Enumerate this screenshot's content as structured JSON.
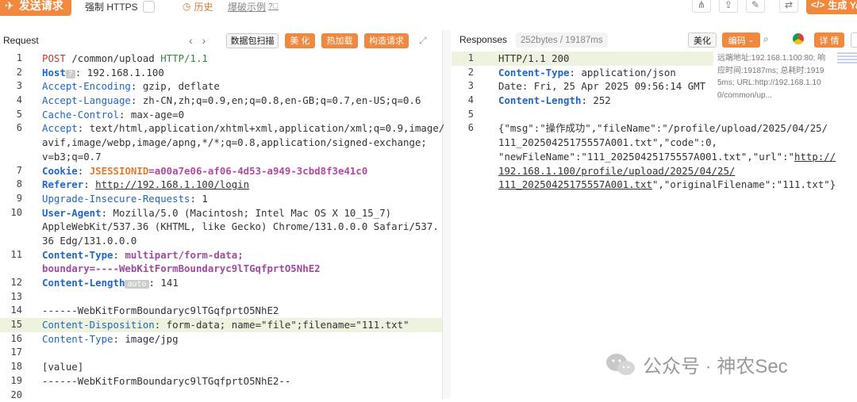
{
  "toolbar": {
    "send_label": "发送请求",
    "https_label": "强制 HTTPS",
    "history_label": "历史",
    "fuzz_label": "爆破示例",
    "generate_label": "生成 Ya"
  },
  "request": {
    "title": "Request",
    "btn_scan": "数据包扫描",
    "btn_beautify": "美 化",
    "btn_hotload": "热加载",
    "btn_construct": "构造请求"
  },
  "response": {
    "title": "Responses",
    "meta": "252bytes / 19187ms",
    "btn_beautify": "美化",
    "btn_encoding": "编码",
    "btn_detail": "详 情",
    "info_line1": "远端地址:192.168.1.100:80; 响",
    "info_line2": "应时间:19187ms; 总耗时:1919",
    "info_line3": "5ms; URL:http://192.168.1.10",
    "info_line4": "0/common/up..."
  },
  "request_lines": [
    {
      "n": "1"
    },
    {
      "n": "2"
    },
    {
      "n": "3"
    },
    {
      "n": "4"
    },
    {
      "n": "5"
    },
    {
      "n": "6"
    },
    {
      "n": ""
    },
    {
      "n": ""
    },
    {
      "n": "7"
    },
    {
      "n": "8"
    },
    {
      "n": "9"
    },
    {
      "n": "10"
    },
    {
      "n": ""
    },
    {
      "n": ""
    },
    {
      "n": "11"
    },
    {
      "n": ""
    },
    {
      "n": "12"
    },
    {
      "n": "13"
    },
    {
      "n": "14"
    },
    {
      "n": "15"
    },
    {
      "n": "16"
    },
    {
      "n": "17"
    },
    {
      "n": "18"
    },
    {
      "n": "19"
    },
    {
      "n": "20"
    }
  ],
  "req": {
    "l1_method": "POST",
    "l1_path": "/common/upload",
    "l1_proto": "HTTP/1.1",
    "l2_key": "Host",
    "l2_chip": "?",
    "l2_val": "192.168.1.100",
    "l3_key": "Accept-Encoding",
    "l3_val": "gzip, deflate",
    "l4_key": "Accept-Language",
    "l4_val": "zh-CN,zh;q=0.9,en;q=0.8,en-GB;q=0.7,en-US;q=0.6",
    "l5_key": "Cache-Control",
    "l5_val": "max-age=0",
    "l6_key": "Accept",
    "l6_val_a": "text/html,application/xhtml+xml,application/xml;q=0.9,image/",
    "l6_val_b": "avif,image/webp,image/apng,*/*;q=0.8,application/signed-exchange;",
    "l6_val_c": "v=b3;q=0.7",
    "l7_key": "Cookie",
    "l7_ck": "JSESSIONID",
    "l7_val": "=a00a7e06-af06-4d53-a949-3cbd8f3e41c0",
    "l8_key": "Referer",
    "l8_val": "http://192.168.1.100/login",
    "l9_key": "Upgrade-Insecure-Requests",
    "l9_val": "1",
    "l10_key": "User-Agent",
    "l10_val_a": "Mozilla/5.0 (Macintosh; Intel Mac OS X 10_15_7)",
    "l10_val_b": "AppleWebKit/537.36 (KHTML, like Gecko) Chrome/131.0.0.0 Safari/537.",
    "l10_val_c": "36 Edg/131.0.0.0",
    "l11_key": "Content-Type",
    "l11_val_a": "multipart/form-data;",
    "l11_val_b": "boundary=----WebKitFormBoundaryc9lTGqfprtO5NhE2",
    "l12_key": "Content-Length",
    "l12_chip": "auto",
    "l12_val": "141",
    "l14": "------WebKitFormBoundaryc9lTGqfprtO5NhE2",
    "l15_key": "Content-Disposition",
    "l15_val": "form-data; name=\"file\";filename=\"111.txt\"",
    "l16_key": "Content-Type",
    "l16_val": "image/jpg",
    "l18": "[value]",
    "l19": "------WebKitFormBoundaryc9lTGqfprtO5NhE2--"
  },
  "resp": {
    "l1": "HTTP/1.1 200",
    "l2_key": "Content-Type",
    "l2_val": "application/json",
    "l3": "Date: Fri, 25 Apr 2025 09:56:14 GMT",
    "l4_key": "Content-Length",
    "l4_val": "252",
    "l6_a": "{\"msg\":\"操作成功\",\"fileName\":\"/profile/upload/2025/04/25/",
    "l6_b": "111_20250425175557A001.txt\",\"code\":0,",
    "l6_c1": "\"newFileName\":\"111_20250425175557A001.txt\",\"url\":\"",
    "l6_c2": "http://",
    "l6_d": "192.168.1.100/profile/upload/2025/04/25/",
    "l6_e1": "111_20250425175557A001.txt",
    "l6_e2": "\",\"originalFilename\":\"111.txt\"}",
    "n1": "1",
    "n2": "2",
    "n3": "3",
    "n4": "4",
    "n5": "5",
    "n6": "6"
  },
  "watermark": "公众号 · 神农Sec"
}
